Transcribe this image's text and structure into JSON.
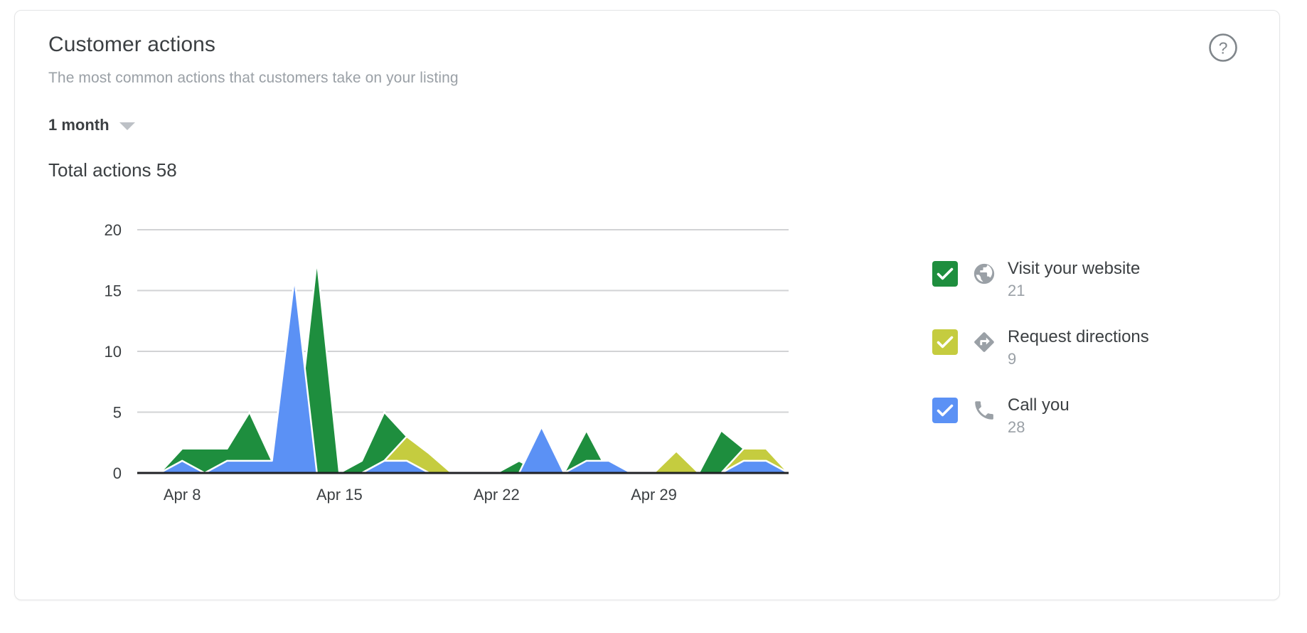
{
  "card": {
    "title": "Customer actions",
    "subtitle": "The most common actions that customers take on your listing",
    "help_icon": "help-circle-icon",
    "range": {
      "selected": "1 month",
      "caret_icon": "chevron-down-icon"
    },
    "total_actions": "Total actions 58"
  },
  "legend": {
    "items": [
      {
        "label": "Visit your website",
        "value": "21",
        "color": "#1e8e3e",
        "icon": "globe-icon",
        "checked": true
      },
      {
        "label": "Request directions",
        "value": "9",
        "color": "#c5cc3f",
        "icon": "directions-icon",
        "checked": true
      },
      {
        "label": "Call you",
        "value": "28",
        "color": "#5b91f5",
        "icon": "phone-icon",
        "checked": true
      }
    ]
  },
  "chart_data": {
    "type": "area",
    "title": "Customer actions",
    "xlabel": "",
    "ylabel": "",
    "ylim": [
      0,
      20
    ],
    "yticks": [
      0,
      5,
      10,
      15,
      20
    ],
    "ytick_labels": [
      "0",
      "5",
      "10",
      "15",
      "20"
    ],
    "grid": true,
    "legend_position": "right",
    "stacked": false,
    "xtick_labels": [
      "Apr 8",
      "Apr 15",
      "Apr 22",
      "Apr 29"
    ],
    "xtick_indices": [
      2,
      9,
      16,
      23
    ],
    "x": [
      "Apr 6",
      "Apr 7",
      "Apr 8",
      "Apr 9",
      "Apr 10",
      "Apr 11",
      "Apr 12",
      "Apr 13",
      "Apr 14",
      "Apr 15",
      "Apr 16",
      "Apr 17",
      "Apr 18",
      "Apr 19",
      "Apr 20",
      "Apr 21",
      "Apr 22",
      "Apr 23",
      "Apr 24",
      "Apr 25",
      "Apr 26",
      "Apr 27",
      "Apr 28",
      "Apr 29",
      "Apr 30",
      "May 1",
      "May 2",
      "May 3",
      "May 4",
      "May 5"
    ],
    "series": [
      {
        "name": "Visit your website",
        "color": "#1e8e3e",
        "total": 21,
        "values": [
          0,
          0,
          2,
          2,
          2,
          5,
          1,
          1,
          17.5,
          0,
          1,
          5,
          3,
          0,
          0,
          0,
          0,
          1,
          0,
          0,
          3.5,
          0,
          0,
          0,
          1,
          0,
          3.5,
          2,
          0,
          0
        ]
      },
      {
        "name": "Request directions",
        "color": "#c5cc3f",
        "total": 9,
        "values": [
          0,
          0,
          0,
          0,
          0,
          0,
          0,
          0,
          0,
          0,
          0,
          1,
          3,
          1.6,
          0,
          0,
          0,
          0,
          0,
          0,
          0,
          0,
          0,
          0,
          1.8,
          0,
          0,
          2,
          2,
          0
        ]
      },
      {
        "name": "Call you",
        "color": "#5b91f5",
        "total": 28,
        "values": [
          0,
          0,
          1,
          0,
          1,
          1,
          1,
          16,
          0,
          0,
          0,
          1,
          1,
          0,
          0,
          0,
          0,
          0,
          3.8,
          0,
          1,
          1,
          0,
          0,
          0,
          0,
          0,
          1,
          1,
          0
        ]
      }
    ]
  }
}
